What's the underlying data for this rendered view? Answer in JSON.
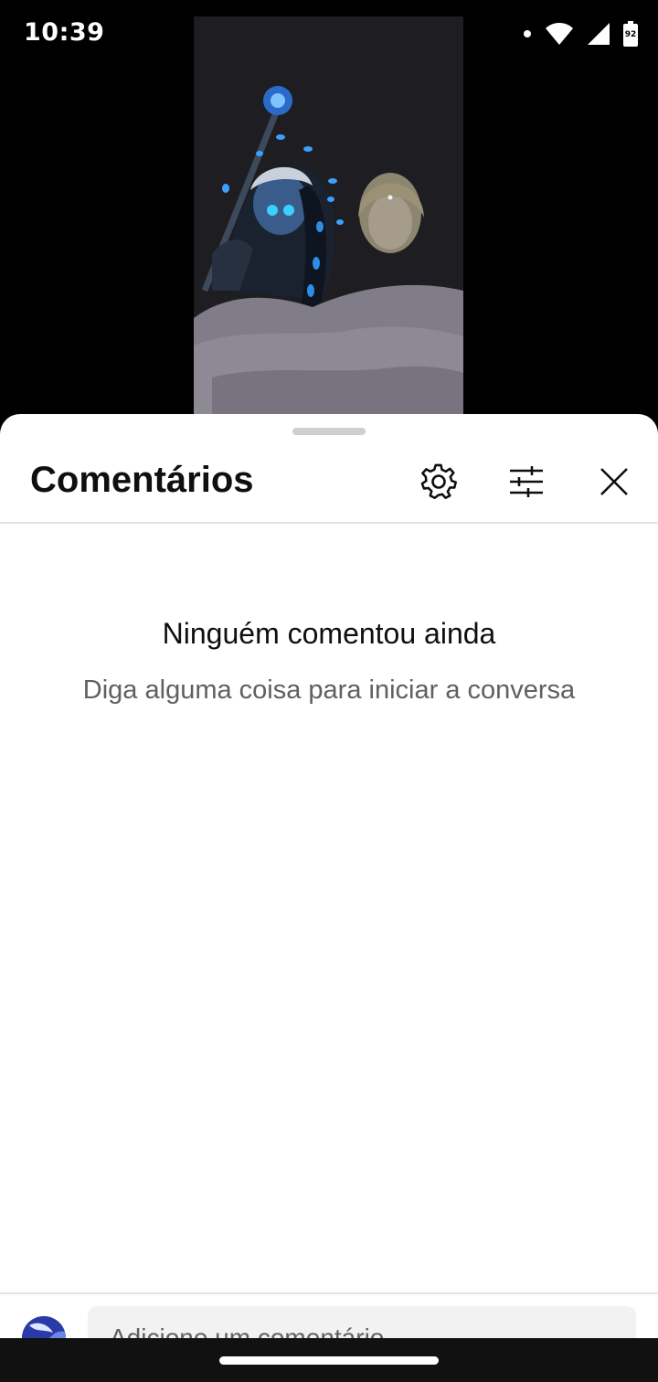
{
  "status_bar": {
    "time": "10:39",
    "battery_level": "92",
    "icons": [
      "notification-dot-icon",
      "wifi-icon",
      "cell-signal-icon",
      "battery-icon"
    ]
  },
  "comments_sheet": {
    "title": "Comentários",
    "header_icons": [
      "gear-icon",
      "sliders-icon",
      "close-icon"
    ],
    "empty_state": {
      "title": "Ninguém comentou ainda",
      "subtitle": "Diga alguma coisa para iniciar a conversa"
    },
    "composer": {
      "placeholder": "Adicione um comentário..."
    }
  },
  "colors": {
    "sheet_background": "#ffffff",
    "divider": "#e3e3e3",
    "primary_text": "#0f0f0f",
    "secondary_text": "#606060"
  }
}
